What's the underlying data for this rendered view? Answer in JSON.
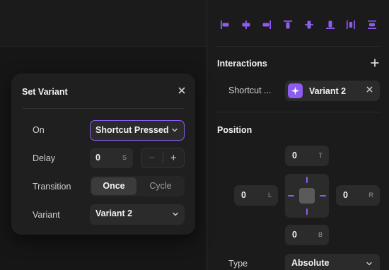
{
  "colors": {
    "accent": "#8e5cf0",
    "panel_bg": "#1b1b1b",
    "field_bg": "#2b2b2b",
    "text": "#f2f2f2",
    "muted": "#cfcfcf"
  },
  "toolbar": {
    "align_icons": [
      "align-left-icon",
      "align-center-horizontal-icon",
      "align-right-icon",
      "align-top-icon",
      "align-center-vertical-icon",
      "align-bottom-icon",
      "distribute-horizontal-icon",
      "distribute-vertical-icon"
    ]
  },
  "interactions": {
    "title": "Interactions",
    "add_icon": "plus-icon",
    "row_label": "Shortcut ...",
    "chip_label": "Variant 2",
    "chip_icon": "sparkle-icon",
    "close_icon": "close-icon"
  },
  "position": {
    "title": "Position",
    "top": {
      "value": "0",
      "suffix": "T"
    },
    "left": {
      "value": "0",
      "suffix": "L"
    },
    "right": {
      "value": "0",
      "suffix": "R"
    },
    "bottom": {
      "value": "0",
      "suffix": "B"
    },
    "type_label": "Type",
    "type_value": "Absolute"
  },
  "popover": {
    "title": "Set Variant",
    "close_icon": "close-icon",
    "on_label": "On",
    "on_value": "Shortcut Pressed",
    "delay_label": "Delay",
    "delay_value": "0",
    "delay_suffix": "S",
    "stepper_minus": "−",
    "stepper_plus": "+",
    "transition_label": "Transition",
    "transition_options": [
      "Once",
      "Cycle"
    ],
    "transition_selected": "Once",
    "variant_label": "Variant",
    "variant_value": "Variant 2"
  }
}
